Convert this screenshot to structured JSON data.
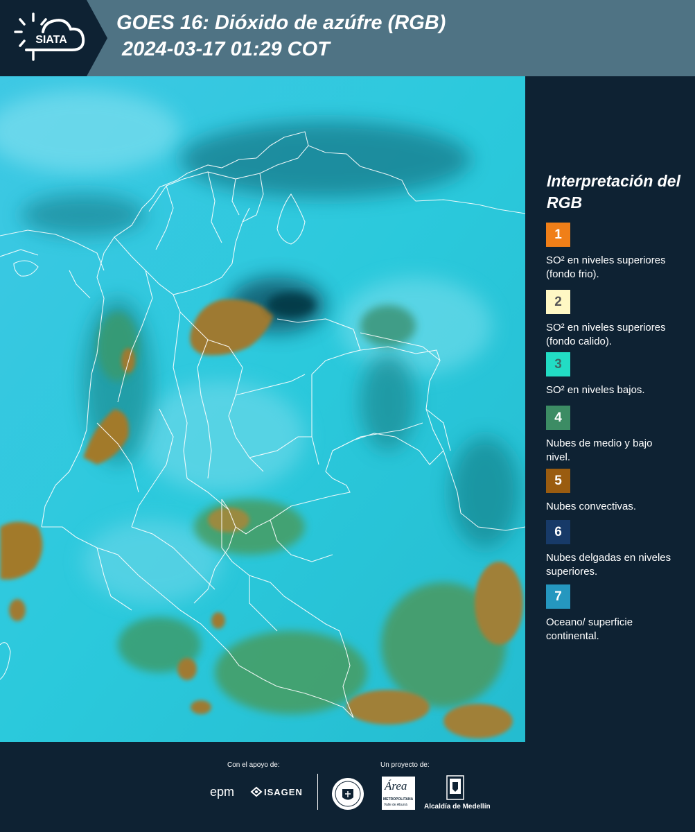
{
  "header": {
    "logo_text": "SIATA",
    "title": "GOES 16: Dióxido de azúfre (RGB)\n 2024-03-17 01:29 COT"
  },
  "legend": {
    "title": "Interpretación del RGB",
    "items": [
      {
        "number": "1",
        "label": "SO² en niveles superiores (fondo frio).",
        "color": "#f07f18",
        "text_color": "#ffffff"
      },
      {
        "number": "2",
        "label": "SO² en niveles superiores (fondo calido).",
        "color": "#fff8c4",
        "text_color": "#555555"
      },
      {
        "number": "3",
        "label": "SO² en niveles bajos.",
        "color": "#22dcc4",
        "text_color": "#3a6a66"
      },
      {
        "number": "4",
        "label": "Nubes de medio y bajo nivel.",
        "color": "#3c8c64",
        "text_color": "#ffffff"
      },
      {
        "number": "5",
        "label": "Nubes convectivas.",
        "color": "#9a5c10",
        "text_color": "#ffffff"
      },
      {
        "number": "6",
        "label": "Nubes delgadas en niveles superiores.",
        "color": "#173a68",
        "text_color": "#ffffff"
      },
      {
        "number": "7",
        "label": "Oceano/ superficie continental.",
        "color": "#2597bf",
        "text_color": "#ffffff"
      }
    ]
  },
  "footer": {
    "support_label": "Con el apoyo de:",
    "project_label": "Un proyecto de:",
    "epm": "epm",
    "isagen": "ISAGEN",
    "area_top": "Área",
    "area_sub": "METROPOLITANA",
    "area_sub2": "Valle de Aburrá",
    "alcaldia": "Alcaldía de Medellín",
    "medellin_seal": "MEDELLÍN"
  },
  "colors": {
    "header_bg": "#4f7384",
    "panel_bg": "#0e2233",
    "map_base": "#2cc6da"
  }
}
